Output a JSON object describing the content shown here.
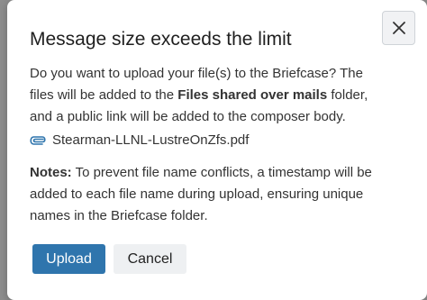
{
  "dialog": {
    "title": "Message size exceeds the limit",
    "close_icon": "close-icon",
    "body": {
      "part1": "Do you want to upload your file(s) to the Briefcase? The files will be added to the ",
      "folder_name": "Files shared over mails",
      "part2": " folder, and a public link will be added to the composer body."
    },
    "attachment": {
      "icon": "paperclip-icon",
      "filename": "Stearman-LLNL-LustreOnZfs.pdf"
    },
    "notes": {
      "label": "Notes:",
      "text": " To prevent file name conflicts, a timestamp will be added to each file name during upload, ensuring unique names in the Briefcase folder."
    },
    "buttons": {
      "primary": "Upload",
      "secondary": "Cancel"
    },
    "colors": {
      "primary_button": "#2f75ad",
      "secondary_button": "#eef0f2",
      "attachment_icon": "#2f75ad"
    }
  }
}
